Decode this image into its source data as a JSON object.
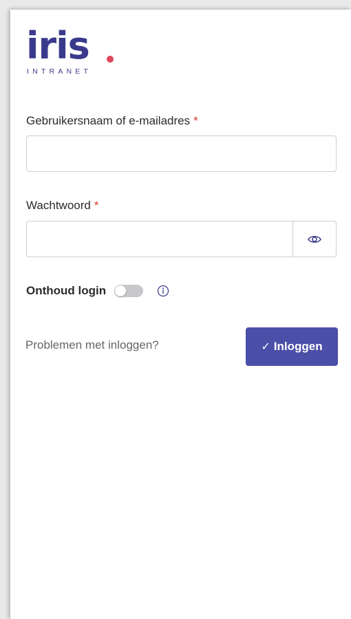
{
  "brand": {
    "name": "iris",
    "subtitle": "INTRANET",
    "primary_color": "#3a3a8c",
    "dot_color": "#e0445a"
  },
  "form": {
    "username": {
      "label": "Gebruikersnaam of e-mailadres",
      "required_mark": "*",
      "value": "",
      "placeholder": ""
    },
    "password": {
      "label": "Wachtwoord",
      "required_mark": "*",
      "value": "",
      "placeholder": ""
    },
    "remember": {
      "label": "Onthoud login",
      "enabled": false
    },
    "problems_link": "Problemen met inloggen?",
    "submit": {
      "label": "Inloggen",
      "icon": "check-icon",
      "color": "#4c4fa8"
    },
    "required_color": "#d9392f"
  },
  "icons": {
    "password_toggle": "eye-icon",
    "remember_info": "info-icon"
  }
}
